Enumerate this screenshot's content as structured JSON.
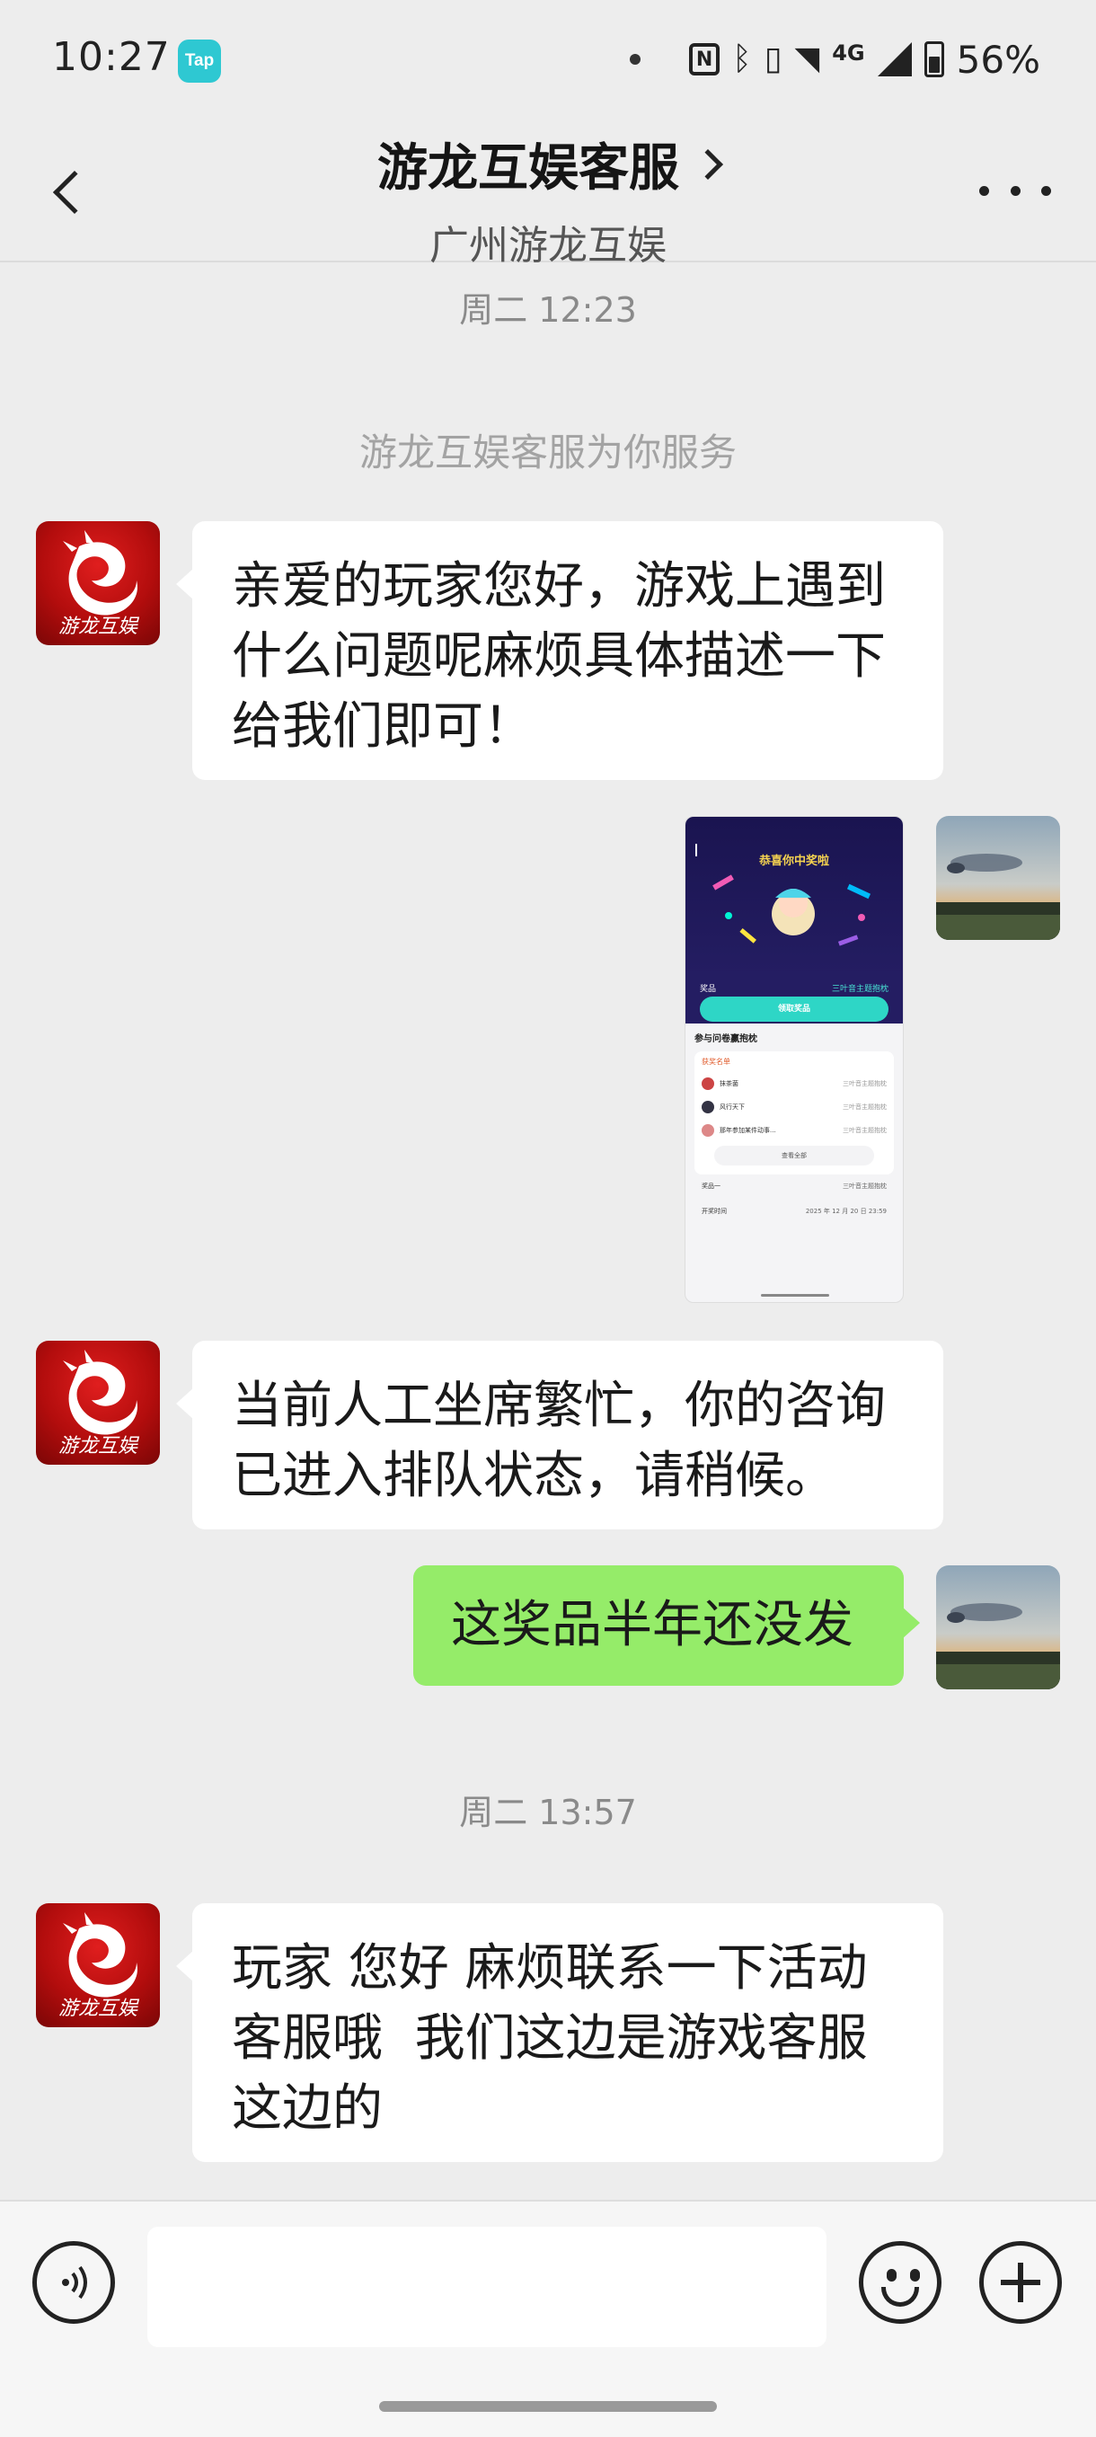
{
  "status_bar": {
    "time": "10:27",
    "app_badge": "Tap",
    "network": "4G",
    "battery": "56%"
  },
  "header": {
    "title": "游龙互娱客服",
    "subtitle": "广州游龙互娱"
  },
  "chat": {
    "timestamp_1": "周二 12:23",
    "system_message": "游龙互娱客服为你服务",
    "message_1": [
      "亲爱的玩家您好，游戏上遇到",
      "什么问题呢麻烦具体描述一下",
      "给我们即可！"
    ],
    "message_3": [
      "当前人工坐席繁忙，你的咨询",
      "已进入排队状态，请稍候。"
    ],
    "message_4": "这奖品半年还没发",
    "timestamp_2": "周二 13:57",
    "message_5": [
      "玩家 您好 麻烦联系一下活动",
      "客服哦  我们这边是游戏客服",
      "这边的"
    ]
  },
  "shared_screenshot": {
    "title": "恭喜你中奖啦",
    "prize_label": "奖品",
    "prize_value": "三叶音主题抱枕",
    "claim_button": "领取奖品",
    "section_title": "参与问卷赢抱枕",
    "winners_title": "获奖名单",
    "winners": [
      {
        "name": "抹茶菌",
        "prize": "三叶音主题抱枕"
      },
      {
        "name": "风行天下",
        "prize": "三叶音主题抱枕"
      },
      {
        "name": "那年参加某件动事...",
        "prize": "三叶音主题抱枕"
      }
    ],
    "view_all": "查看全部",
    "prize_row_label": "奖品一",
    "prize_row_value": "三叶音主题抱枕",
    "draw_time_label": "开奖时间",
    "draw_time_value": "2025 年 12 月 20 日 23:59"
  },
  "colors": {
    "background": "#ededed",
    "bubble_incoming": "#ffffff",
    "bubble_outgoing": "#95ec69",
    "brand_red": "#b30d0d"
  }
}
